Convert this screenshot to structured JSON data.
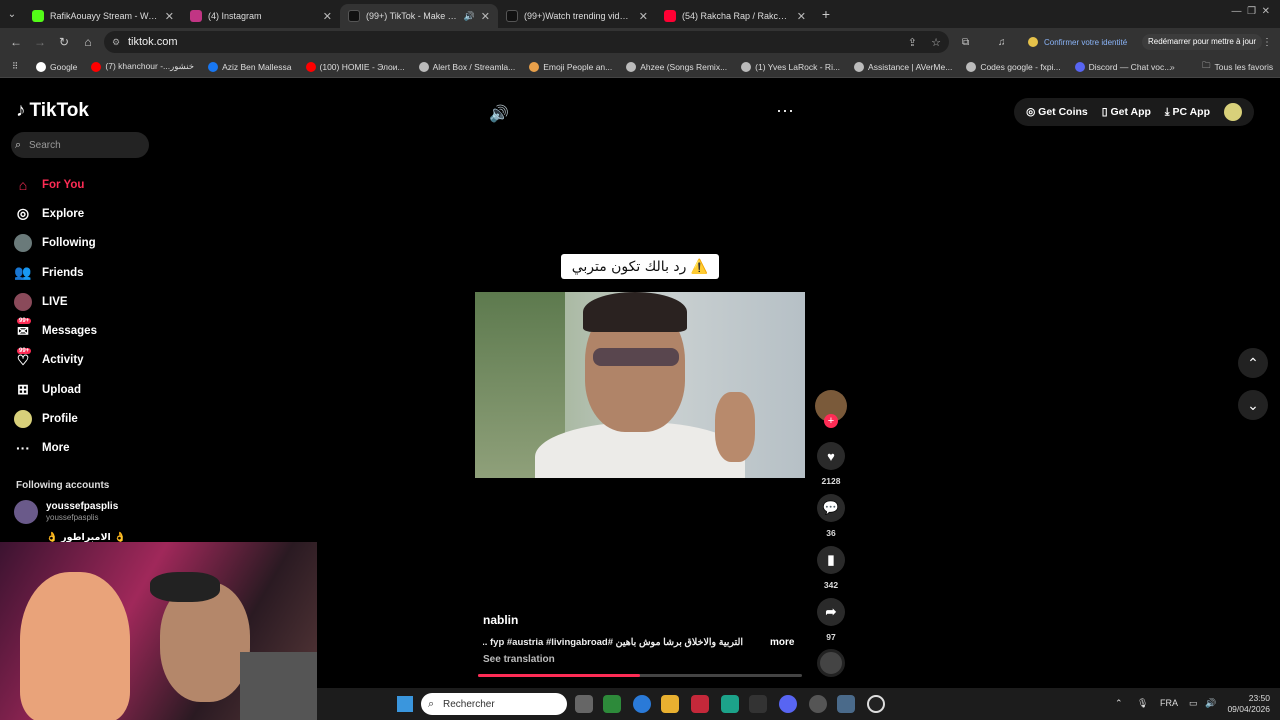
{
  "tabs": [
    {
      "label": "RafikAouayy Stream - Watch Li",
      "color": "#53fc18"
    },
    {
      "label": "(4) Instagram",
      "color": "#e1306c"
    },
    {
      "label": "(99+) TikTok - Make Your Da",
      "color": "#000000"
    },
    {
      "label": "(99+)Watch trending videos for",
      "color": "#000000"
    },
    {
      "label": "(54) Rakcha Rap / Rakcha Prod",
      "color": "#ff0000"
    }
  ],
  "address": {
    "url": "tiktok.com",
    "confirm_identity": "Confirmer votre identité",
    "restart": "Redémarrer pour mettre à jour"
  },
  "bookmarks": [
    "Google",
    "(7) khanchour -...خنشور",
    "Aziz Ben Mallessa",
    "(100) HOMIE - Элои...",
    "Alert Box / Streamla...",
    "Emoji People an...",
    "Ahzee (Songs Remix...",
    "(1) Yves LaRock - Ri...",
    "Assistance | AVerMe...",
    "Codes google - fxpi...",
    "Discord — Chat voc..."
  ],
  "bookmarks_all": "Tous les favoris",
  "tiktok": {
    "logo": "TikTok",
    "search_placeholder": "Search",
    "menu": [
      {
        "label": "For You",
        "icon": "home-icon",
        "active": true
      },
      {
        "label": "Explore",
        "icon": "compass-icon"
      },
      {
        "label": "Following",
        "icon": "following-avatar-icon"
      },
      {
        "label": "Friends",
        "icon": "friends-icon"
      },
      {
        "label": "LIVE",
        "icon": "live-icon"
      },
      {
        "label": "Messages",
        "icon": "messages-icon",
        "badge": "99+"
      },
      {
        "label": "Activity",
        "icon": "activity-icon",
        "badge": "99+"
      },
      {
        "label": "Upload",
        "icon": "upload-icon"
      },
      {
        "label": "Profile",
        "icon": "profile-icon"
      },
      {
        "label": "More",
        "icon": "more-icon"
      }
    ],
    "following_title": "Following accounts",
    "following_accounts": [
      {
        "name": "youssefpasplis",
        "handle": "youssefpasplis"
      },
      {
        "name": "👌 الامبراطور 👌"
      }
    ],
    "top_actions": {
      "coins": "Get Coins",
      "app": "Get App",
      "pc": "PC App"
    },
    "video": {
      "caption": "رد بالك تكون متربي ⚠️",
      "author": "nablin",
      "description": "التربية والاخلاق برشا موش باهين #fyp #austria #livingabroad ...",
      "more": "more",
      "see_translation": "See translation",
      "likes": "2128",
      "comments": "36",
      "saves": "342",
      "shares": "97",
      "progress": 0.5
    }
  },
  "taskbar": {
    "search": "Rechercher",
    "lang": "FRA",
    "time": "23:50",
    "date": "09/04/2026"
  }
}
